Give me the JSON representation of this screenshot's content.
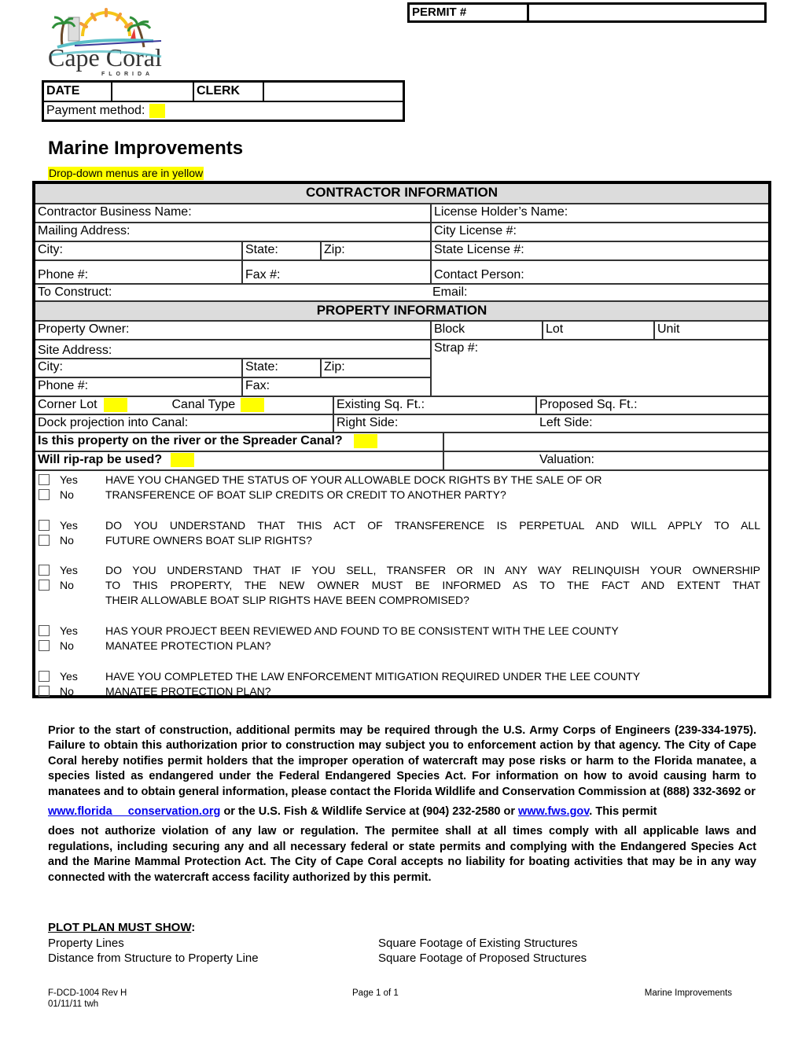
{
  "header": {
    "permit_label": "PERMIT #",
    "permit_value": "",
    "logo": {
      "name": "Cape Coral",
      "sub": "FLORIDA"
    },
    "date_label": "DATE",
    "date_value": "",
    "clerk_label": "CLERK",
    "clerk_value": "",
    "payment_label": "Payment method:",
    "payment_value": ""
  },
  "title": "Marine Improvements",
  "dropdown_note": "Drop-down menus are in yellow",
  "colors": {
    "dropdown": "#ffff00",
    "section_header": "#dcdcdc",
    "link": "#0000ee"
  },
  "contractor": {
    "heading": "CONTRACTOR INFORMATION",
    "business_name": "Contractor Business Name:",
    "license_holder": "License Holder’s Name:",
    "mailing_address": "Mailing Address:",
    "city_license": "City License #:",
    "city": "City:",
    "state": "State:",
    "zip": "Zip:",
    "state_license": "State License #:",
    "phone": "Phone #:",
    "fax": "Fax #:",
    "contact_person": "Contact Person:",
    "to_construct": "To Construct:",
    "email": "Email:"
  },
  "property": {
    "heading": "PROPERTY INFORMATION",
    "owner": "Property Owner:",
    "block": "Block",
    "lot": "Lot",
    "unit": "Unit",
    "site_address": "Site Address:",
    "strap": "Strap #:",
    "city": "City:",
    "state": "State:",
    "zip": "Zip:",
    "phone": "Phone #:",
    "fax": "Fax:",
    "corner_lot": "Corner Lot",
    "canal_type": "Canal Type",
    "existing_sqft": "Existing Sq. Ft.:",
    "proposed_sqft": "Proposed Sq. Ft.:",
    "dock_projection": "Dock projection into Canal:",
    "right_side": "Right Side:",
    "left_side": "Left Side:",
    "river_question": "Is this property on the river or the Spreader Canal?",
    "riprap_question": "Will rip-rap be used?",
    "valuation": "Valuation:"
  },
  "questions": [
    {
      "yes": "Yes",
      "no": "No",
      "lines": [
        "HAVE YOU CHANGED THE STATUS OF YOUR ALLOWABLE DOCK RIGHTS BY THE SALE OF OR",
        "TRANSFERENCE OF BOAT SLIP CREDITS OR CREDIT TO ANOTHER PARTY?"
      ]
    },
    {
      "yes": "Yes",
      "no": "No",
      "lines": [
        "DO YOU UNDERSTAND THAT THIS ACT OF TRANSFERENCE IS PERPETUAL AND WILL APPLY TO ALL",
        "FUTURE OWNERS BOAT SLIP RIGHTS?"
      ]
    },
    {
      "yes": "Yes",
      "no": "No",
      "lines": [
        "DO YOU UNDERSTAND THAT IF YOU SELL, TRANSFER OR IN ANY WAY RELINQUISH YOUR OWNERSHIP",
        "TO THIS PROPERTY, THE NEW OWNER MUST BE INFORMED AS TO THE FACT AND EXTENT THAT",
        "THEIR ALLOWABLE BOAT SLIP RIGHTS HAVE BEEN COMPROMISED?"
      ]
    },
    {
      "yes": "Yes",
      "no": "No",
      "lines": [
        "HAS YOUR PROJECT BEEN REVIEWED AND FOUND TO BE CONSISTENT WITH THE LEE COUNTY",
        "MANATEE PROTECTION PLAN?"
      ]
    },
    {
      "yes": "Yes",
      "no": "No",
      "lines": [
        "HAVE YOU COMPLETED THE LAW ENFORCEMENT MITIGATION REQUIRED UNDER THE LEE COUNTY",
        "MANATEE PROTECTION PLAN?"
      ]
    }
  ],
  "notice": {
    "p1": "Prior to the start of construction, additional permits may be required through the U.S. Army Corps of Engineers (239-334-1975).  Failure to obtain this authorization prior to construction may subject you to enforcement action by that agency.  The City of Cape Coral hereby notifies permit holders that the improper operation of watercraft may pose risks or harm to the Florida manatee, a species listed as endangered under the Federal Endangered Species Act.  For information on how to avoid causing harm to manatees and to obtain general information, please contact the Florida Wildlife and Conservation Commission at (888) 332-3692 or",
    "link1": "www.florida     conservation.org",
    "mid": " or the U.S. Fish & Wildlife Service at (904) 232-2580 or ",
    "link2": "www.fws.gov",
    "tail": ".  This permit",
    "p3": "does not authorize violation of any law or regulation.  The permitee shall at all times comply with all applicable laws and regulations, including securing any and all necessary federal or state permits and complying with the Endangered Species Act and the Marine Mammal Protection Act.  The City of Cape Coral accepts no liability for boating activities that may be in any way connected with the watercraft access facility authorized by this permit."
  },
  "plot_plan": {
    "heading": "PLOT PLAN MUST SHOW",
    "colon": ":",
    "items": [
      "Property Lines",
      "Square Footage of Existing Structures",
      "Distance from Structure to Property Line",
      "Square Footage of Proposed Structures"
    ]
  },
  "footer": {
    "form_id": "F-DCD-1004 Rev H",
    "date": "01/11/11 twh",
    "page": "Page 1 of 1",
    "form_name": "Marine Improvements"
  }
}
